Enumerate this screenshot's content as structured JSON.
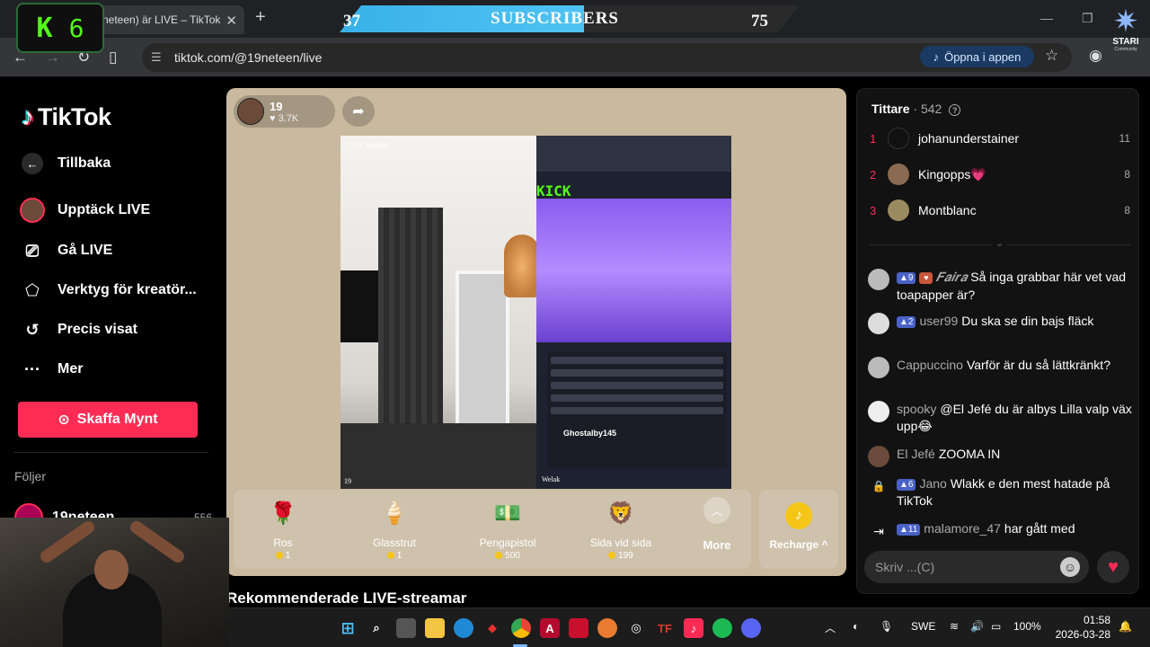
{
  "browser": {
    "tab_title": "neteen) är LIVE – TikTok",
    "tab_close": "✕",
    "new_tab": "+",
    "url": "tiktok.com/@19neteen/live",
    "open_app": "Öppna i appen"
  },
  "overlay": {
    "kick_letter": "K",
    "kick_count": "6",
    "sub_current": "37",
    "sub_label": "SUBSCRIBERS",
    "sub_goal": "75",
    "stari_title": "STARI",
    "stari_sub": "Community"
  },
  "sidebar": {
    "logo": "TikTok",
    "back": "Tillbaka",
    "items": [
      {
        "label": "Upptäck LIVE"
      },
      {
        "label": "Gå LIVE"
      },
      {
        "label": "Verktyg för kreatör..."
      },
      {
        "label": "Precis visat"
      },
      {
        "label": "Mer"
      }
    ],
    "coins_button": "Skaffa Mynt",
    "following_header": "Följer",
    "following": [
      {
        "name": "19neteen",
        "count": "556"
      }
    ]
  },
  "stream": {
    "host_name": "19",
    "likes": "3.7K",
    "tag_creator": "LIVE-kreatör",
    "tag_num": "19",
    "tag_guest": "Welak",
    "inset_kick": "KICK",
    "inset_name": "Ghostalby145"
  },
  "gifts": [
    {
      "name": "Ros",
      "price": "1",
      "icon": "🌹"
    },
    {
      "name": "Glasstrut",
      "price": "1",
      "icon": "🍦"
    },
    {
      "name": "Pengapistol",
      "price": "500",
      "icon": "💵"
    },
    {
      "name": "Sida vid sida",
      "price": "199",
      "icon": "🦁"
    }
  ],
  "gift_more": "More",
  "recharge": "Recharge",
  "recommend_title": "Rekommenderade LIVE-streamar",
  "viewers": {
    "label": "Tittare",
    "count": "· 542",
    "top": [
      {
        "rank": "1",
        "name": "johanunderstainer",
        "score": "11",
        "color": "#111111"
      },
      {
        "rank": "2",
        "name": "Kingopps💗",
        "score": "8",
        "color": "#8a6a50"
      },
      {
        "rank": "3",
        "name": "Montblanc",
        "score": "8",
        "color": "#9a8a60"
      }
    ]
  },
  "chat": [
    {
      "badge": "9",
      "user": "𝑭𝒂𝒊𝒓𝒂",
      "text": "Så inga grabbar här vet vad toapapper är?",
      "color": "#bbbbbb"
    },
    {
      "badge": "2",
      "user": "user99",
      "text": "Du ska se din bajs fläck",
      "color": "#dddddd"
    },
    {
      "badge": "",
      "user": "Cappuccino",
      "text": "Varför är du så lättkränkt?",
      "color": "#bbbbbb"
    },
    {
      "badge": "",
      "user": "spooky",
      "text": "@El Jefé du är albys Lilla valp väx upp😂",
      "color": "#eeeeee"
    },
    {
      "badge": "",
      "user": "El Jefé",
      "text": "ZOOMA IN",
      "color": "#6a4a3a"
    },
    {
      "badge": "6",
      "user": "Jano",
      "text": "Wlakk e den mest hatade på TikTok",
      "color": "#121212"
    },
    {
      "badge": "11",
      "user": "malamore_47",
      "text": "har gått med",
      "color": "#121212"
    }
  ],
  "chat_input_placeholder": "Skriv ...(C)",
  "taskbar": {
    "lang": "SWE",
    "battery": "100%",
    "time": "01:58",
    "date": "2026-03-28"
  }
}
